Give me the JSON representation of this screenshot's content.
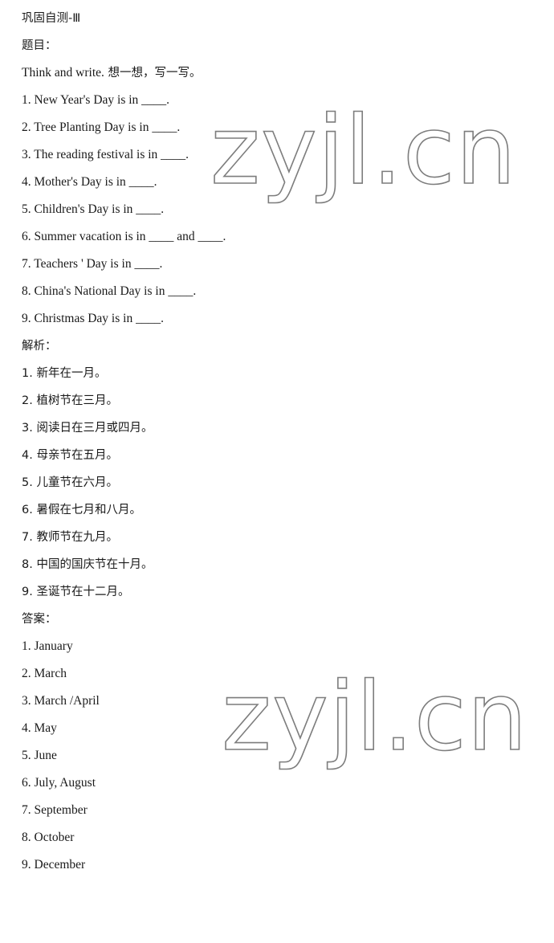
{
  "document": {
    "title": "巩固自测-Ⅲ",
    "watermark": "zyjl.cn",
    "watermark_color": "#7d7d7d"
  },
  "sections": {
    "questions_heading": "题目：",
    "analysis_heading": "解析：",
    "answers_heading": "答案："
  },
  "prompt": {
    "english": "Think and write.",
    "chinese": "想一想，写一写。"
  },
  "questions": [
    "1. New Year's Day is in ____.",
    "2. Tree Planting Day is in ____.",
    "3. The reading festival is in ____.",
    "4. Mother's Day is in ____.",
    "5. Children's Day is in ____.",
    "6. Summer vacation is in ____ and ____.",
    "7. Teachers ' Day is in ____.",
    "8. China's National Day is in ____.",
    "9. Christmas Day is in ____."
  ],
  "analysis": [
    "1. 新年在一月。",
    "2. 植树节在三月。",
    "3. 阅读日在三月或四月。",
    "4. 母亲节在五月。",
    "5. 儿童节在六月。",
    "6. 暑假在七月和八月。",
    "7. 教师节在九月。",
    "8. 中国的国庆节在十月。",
    "9. 圣诞节在十二月。"
  ],
  "answers": [
    "1. January",
    "2. March",
    "3. March /April",
    "4. May",
    "5. June",
    "6. July, August",
    "7. September",
    "8. October",
    "9. December"
  ]
}
